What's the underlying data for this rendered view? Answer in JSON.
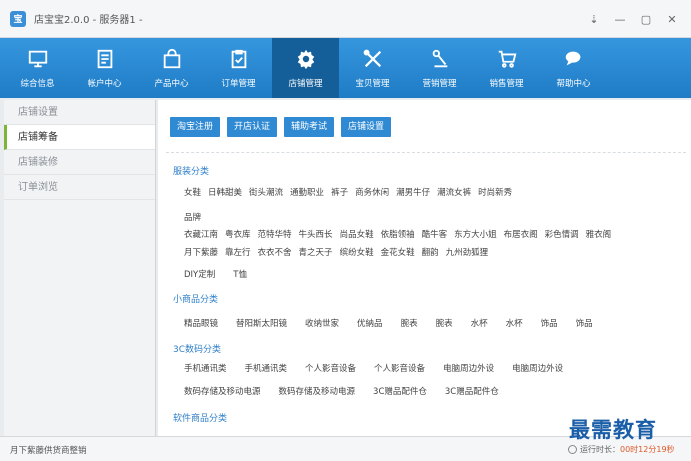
{
  "window": {
    "title": "店宝宝2.0.0 - 服务器1 -",
    "logo": "宝",
    "controls": [
      "⇣",
      "—",
      "▢",
      "✕"
    ]
  },
  "nav": [
    {
      "label": "综合信息",
      "icon": "monitor-icon"
    },
    {
      "label": "帐户中心",
      "icon": "document-icon"
    },
    {
      "label": "产品中心",
      "icon": "shopping-bag-icon"
    },
    {
      "label": "订单管理",
      "icon": "clipboard-check-icon"
    },
    {
      "label": "店铺管理",
      "icon": "gear-icon",
      "active": true
    },
    {
      "label": "宝贝管理",
      "icon": "tools-icon"
    },
    {
      "label": "营销管理",
      "icon": "megaphone-icon"
    },
    {
      "label": "销售管理",
      "icon": "cart-icon"
    },
    {
      "label": "帮助中心",
      "icon": "chat-bubbles-icon"
    }
  ],
  "sidebar": [
    {
      "label": "店铺设置"
    },
    {
      "label": "店铺筹备",
      "active": true
    },
    {
      "label": "店铺装修"
    },
    {
      "label": "订单浏览"
    }
  ],
  "actions": [
    "淘宝注册",
    "开店认证",
    "辅助考试",
    "店铺设置"
  ],
  "categories": [
    {
      "title": "服装分类",
      "rows": [
        [
          "女鞋",
          "日韩甜美",
          "街头潮流",
          "通勤职业",
          "裤子",
          "商务休闲",
          "潮男牛仔",
          "潮流女裤",
          "时尚新秀"
        ],
        [
          "品牌"
        ],
        [
          "衣藏江南",
          "粤衣库",
          "范特华特",
          "牛头西长",
          "尚品女鞋",
          "依脂领袖",
          "酷牛客",
          "东方大小姐",
          "布居衣阁",
          "彩色情调",
          "雅衣阁"
        ],
        [
          "月下紫藤",
          "靠左行",
          "衣衣不舍",
          "青之天子",
          "缤纷女鞋",
          "金花女鞋",
          "翻韵",
          "九州劲狐狸"
        ],
        [
          "DIY定制",
          "T恤"
        ]
      ]
    },
    {
      "title": "小商品分类",
      "rows": [
        [
          "精品眼镜",
          "替阳斯太阳镜",
          "收纳世家",
          "优納品",
          "腕表",
          "腕表",
          "水杯",
          "水杯",
          "饰品",
          "饰品"
        ]
      ]
    },
    {
      "title": "3C数码分类",
      "rows": [
        [
          "手机通讯类",
          "手机通讯类",
          "个人影音设备",
          "个人影音设备",
          "电脑周边外设",
          "电脑周边外设"
        ],
        [
          "数码存储及移动电源",
          "数码存储及移动电源",
          "3C赠品配件仓",
          "3C赠品配件仓"
        ]
      ]
    },
    {
      "title": "软件商品分类",
      "rows": []
    }
  ],
  "status": {
    "left": "月下紫藤供货商整销",
    "time_label": "运行时长：",
    "time_value": "00时12分19秒"
  },
  "watermark": "最需教育"
}
